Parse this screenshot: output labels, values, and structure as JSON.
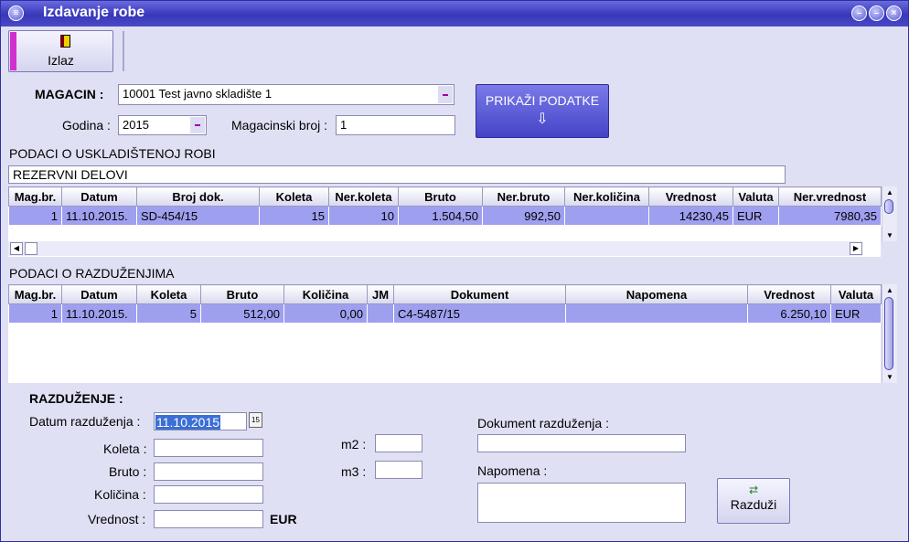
{
  "window": {
    "title": "Izdavanje robe"
  },
  "toolbar": {
    "exit_label": "Izlaz"
  },
  "filters": {
    "magacin_label": "MAGACIN :",
    "magacin_value": "10001 Test javno skladište 1",
    "godina_label": "Godina :",
    "godina_value": "2015",
    "magbroj_label": "Magacinski broj :",
    "magbroj_value": "1",
    "show_button_label": "PRIKAŽI PODATKE",
    "show_button_icon": "arrow-down-icon"
  },
  "stored": {
    "section_title": "PODACI O USKLADIŠTENOJ ROBI",
    "category": "REZERVNI DELOVI",
    "columns": [
      "Mag.br.",
      "Datum",
      "Broj dok.",
      "Koleta",
      "Ner.koleta",
      "Bruto",
      "Ner.bruto",
      "Ner.količina",
      "Vrednost",
      "Valuta",
      "Ner.vrednost"
    ],
    "rows": [
      [
        "1",
        "11.10.2015.",
        "SD-454/15",
        "15",
        "10",
        "1.504,50",
        "992,50",
        "",
        "14230,45",
        "EUR",
        "7980,35"
      ]
    ]
  },
  "discharges": {
    "section_title": "PODACI O RAZDUŽENJIMA",
    "columns": [
      "Mag.br.",
      "Datum",
      "Koleta",
      "Bruto",
      "Količina",
      "JM",
      "Dokument",
      "Napomena",
      "Vrednost",
      "Valuta"
    ],
    "rows": [
      [
        "1",
        "11.10.2015.",
        "5",
        "512,00",
        "0,00",
        "",
        "C4-5487/15",
        "",
        "6.250,10",
        "EUR"
      ]
    ]
  },
  "form": {
    "title": "RAZDUŽENJE :",
    "date_label": "Datum razduženja :",
    "date_value": "11.10.2015",
    "date_picker_icon": "calendar-icon",
    "koleta_label": "Koleta :",
    "bruto_label": "Bruto :",
    "kolicina_label": "Količina :",
    "vrednost_label": "Vrednost :",
    "currency": "EUR",
    "m2_label": "m2 :",
    "m3_label": "m3 :",
    "document_label": "Dokument razduženja :",
    "note_label": "Napomena :",
    "submit_label": "Razduži"
  }
}
